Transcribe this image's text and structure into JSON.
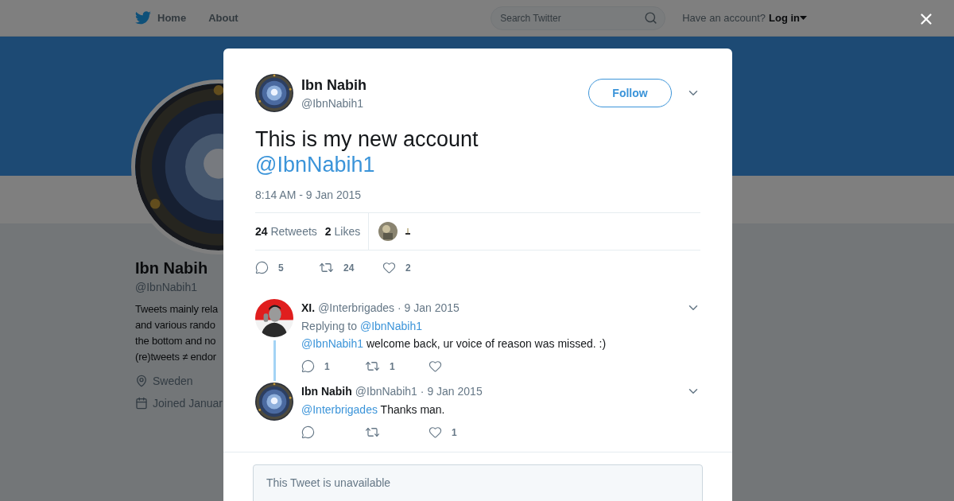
{
  "nav": {
    "items": [
      {
        "label": "Home",
        "kind": "home"
      },
      {
        "label": "About",
        "kind": "plain"
      }
    ],
    "search": {
      "placeholder": "Search Twitter"
    },
    "account": {
      "prompt": "Have an account?",
      "login": "Log in"
    }
  },
  "profile": {
    "name": "Ibn Nabih",
    "handle": "@IbnNabih1",
    "bio": [
      "Tweets mainly rela",
      "and various rando",
      "the bottom and no",
      "(re)tweets ≠ endor"
    ],
    "location": "Sweden",
    "joined": "Joined Januar"
  },
  "tweet": {
    "name": "Ibn Nabih",
    "handle": "@IbnNabih1",
    "follow": "Follow",
    "text": "This is my new account",
    "mention": "@IbnNabih1",
    "timestamp": "8:14 AM - 9 Jan 2015",
    "stats": [
      {
        "count": "24",
        "label": "Retweets"
      },
      {
        "count": "2",
        "label": "Likes"
      }
    ],
    "actions": [
      {
        "kind": "reply",
        "count": "5"
      },
      {
        "kind": "retweet",
        "count": "24"
      },
      {
        "kind": "like",
        "count": "2"
      }
    ]
  },
  "replies": [
    {
      "name": "XI.",
      "handle": "@Interbrigades",
      "date": "· 9 Jan 2015",
      "replying_to": {
        "label": "Replying to",
        "handle": "@IbnNabih1"
      },
      "mention": "@IbnNabih1",
      "text": "welcome back, ur voice of reason was missed. :)",
      "actions": [
        {
          "kind": "reply",
          "count": "1"
        },
        {
          "kind": "retweet",
          "count": "1"
        },
        {
          "kind": "like"
        }
      ]
    },
    {
      "name": "Ibn Nabih",
      "handle": "@IbnNabih1",
      "date": "· 9 Jan 2015",
      "mention": "@Interbrigades",
      "text": "Thanks man.",
      "actions": [
        {
          "kind": "reply"
        },
        {
          "kind": "retweet"
        },
        {
          "kind": "like",
          "count": "1"
        }
      ]
    }
  ],
  "unavailable": "This Tweet is unavailable"
}
